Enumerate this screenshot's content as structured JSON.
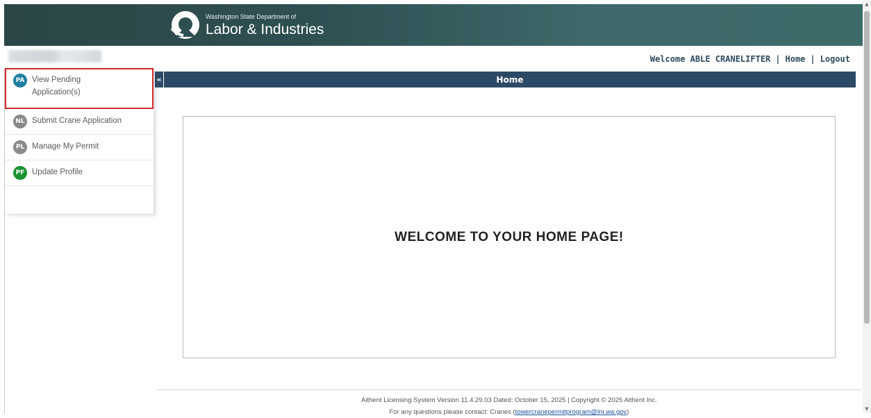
{
  "header": {
    "agency_small": "Washington State Department of",
    "agency_big": "Labor & Industries",
    "logo_icon": "lni-logo-icon"
  },
  "topnav": {
    "welcome": "Welcome ABLE CRANELIFTER",
    "home": "Home",
    "logout": "Logout",
    "separator": "|"
  },
  "sidebar": {
    "items": [
      {
        "badge": "PA",
        "label": "View Pending Application(s)",
        "color": "#1e7fa0"
      },
      {
        "badge": "NL",
        "label": "Submit Crane Application",
        "color": "#8a8a8a"
      },
      {
        "badge": "PL",
        "label": "Manage My Permit",
        "color": "#8a8a8a"
      },
      {
        "badge": "PF",
        "label": "Update Profile",
        "color": "#1a9230"
      }
    ]
  },
  "content": {
    "collapse_icon": "«",
    "bar_title": "Home",
    "welcome_heading": "WELCOME TO YOUR HOME PAGE!"
  },
  "footer": {
    "version_line": "Aithent Licensing System Version 11.4.29.03 Dated: October 15, 2025 | Copyright © 2025 Aithent Inc.",
    "contact_prefix": "For any questions please contact: Cranes (",
    "contact_email": "towercranepermitprogram@lni.wa.gov",
    "contact_suffix": ")"
  },
  "colors": {
    "nav_bar": "#2c4a66",
    "highlight_border": "#d22a2a",
    "link": "#1b4f9c"
  }
}
